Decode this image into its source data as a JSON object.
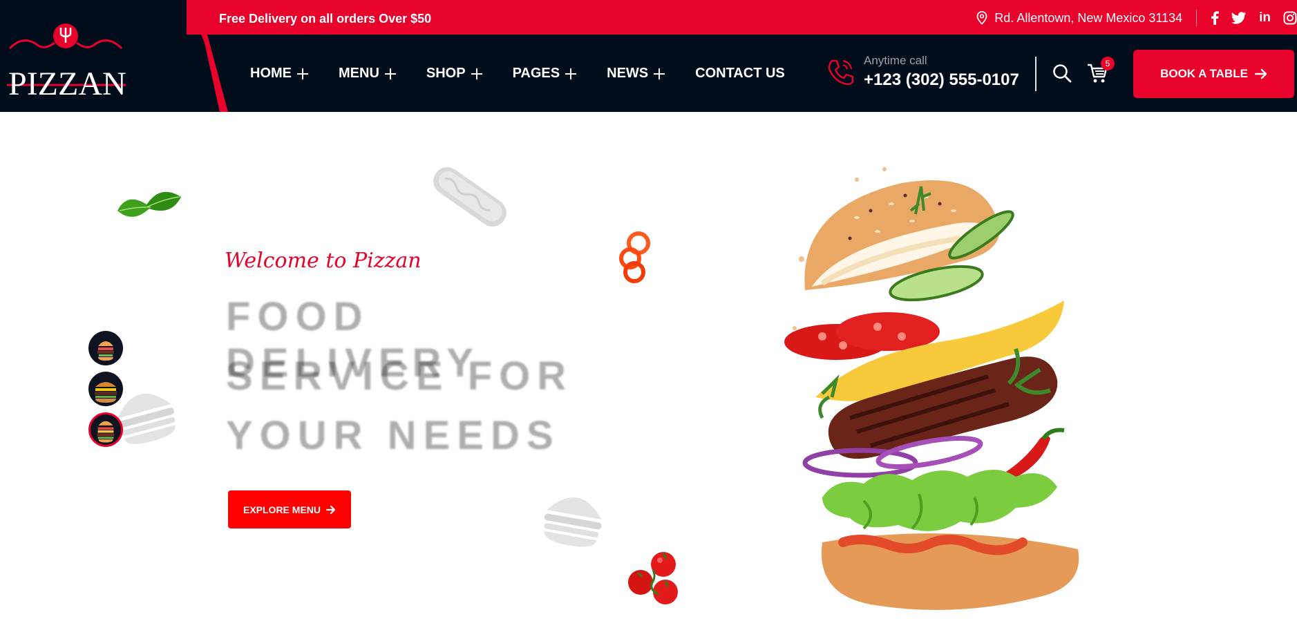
{
  "brand": {
    "name": "PIZZAN"
  },
  "topbar": {
    "promo": "Free Delivery on all orders Over $50",
    "address": "Rd. Allentown, New Mexico 31134",
    "social": [
      "facebook-icon",
      "twitter-icon",
      "linkedin-icon",
      "instagram-icon"
    ]
  },
  "nav": {
    "items": [
      {
        "label": "HOME",
        "has_submenu": true
      },
      {
        "label": "MENU",
        "has_submenu": true
      },
      {
        "label": "SHOP",
        "has_submenu": true
      },
      {
        "label": "PAGES",
        "has_submenu": true
      },
      {
        "label": "NEWS",
        "has_submenu": true
      },
      {
        "label": "CONTACT US",
        "has_submenu": false
      }
    ]
  },
  "contact": {
    "label": "Anytime call",
    "phone": "+123 (302) 555-0107"
  },
  "cart": {
    "count": "5"
  },
  "book_button": {
    "label": "BOOK A TABLE"
  },
  "hero": {
    "welcome": "Welcome to Pizzan",
    "headline": [
      "FOOD DELIVERY",
      "SERVICE FOR",
      "YOUR NEEDS"
    ],
    "cta": "EXPLORE MENU"
  },
  "colors": {
    "accent": "#e8012a",
    "dark": "#020d1c",
    "cta": "#ff0000"
  }
}
